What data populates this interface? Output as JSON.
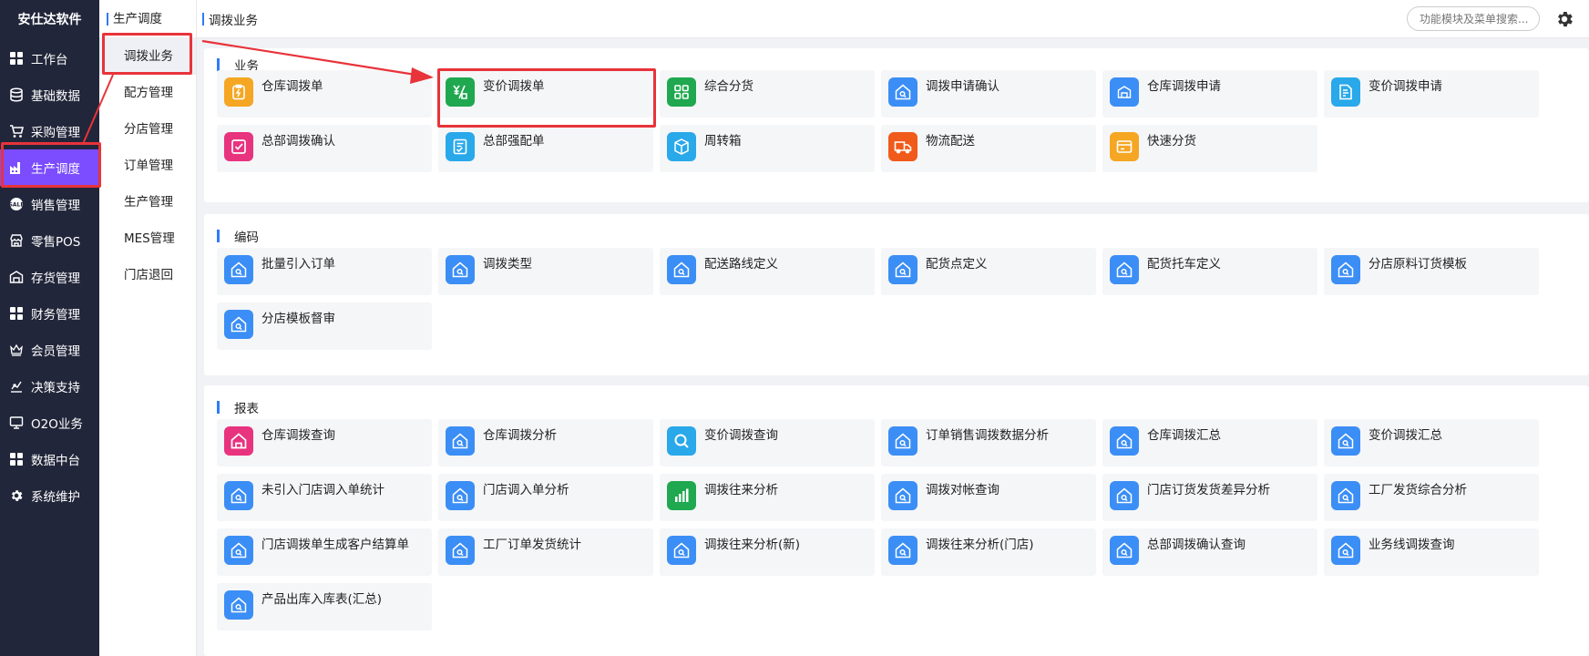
{
  "brand": "安仕达软件",
  "nav": [
    {
      "label": "工作台",
      "icon": "grid-icon"
    },
    {
      "label": "基础数据",
      "icon": "database-icon"
    },
    {
      "label": "采购管理",
      "icon": "cart-icon"
    },
    {
      "label": "生产调度",
      "icon": "factory-icon"
    },
    {
      "label": "销售管理",
      "icon": "sale-badge-icon"
    },
    {
      "label": "零售POS",
      "icon": "store-icon"
    },
    {
      "label": "存货管理",
      "icon": "warehouse-icon"
    },
    {
      "label": "财务管理",
      "icon": "grid-icon"
    },
    {
      "label": "会员管理",
      "icon": "crown-icon"
    },
    {
      "label": "决策支持",
      "icon": "chart-line-icon"
    },
    {
      "label": "O2O业务",
      "icon": "monitor-icon"
    },
    {
      "label": "数据中台",
      "icon": "grid-icon"
    },
    {
      "label": "系统维护",
      "icon": "gear-icon"
    }
  ],
  "submenu": {
    "title": "生产调度",
    "items": [
      "调拨业务",
      "配方管理",
      "分店管理",
      "订单管理",
      "生产管理",
      "MES管理",
      "门店退回"
    ]
  },
  "topbar": {
    "breadcrumb": "调拨业务",
    "search_placeholder": "功能模块及菜单搜索..."
  },
  "sections": [
    {
      "title": "业务",
      "items": [
        {
          "label": "仓库调拨单",
          "icon": "clipboard-bolt-icon",
          "color": "#f5a623"
        },
        {
          "label": "变价调拨单",
          "icon": "price-change-icon",
          "color": "#1fa84f"
        },
        {
          "label": "综合分货",
          "icon": "apps-icon",
          "color": "#1fa84f"
        },
        {
          "label": "调拨申请确认",
          "icon": "house-search-icon",
          "color": "#3b8ef5"
        },
        {
          "label": "仓库调拨申请",
          "icon": "warehouse-icon",
          "color": "#3b8ef5"
        },
        {
          "label": "变价调拨申请",
          "icon": "document-icon",
          "color": "#29a8ea"
        },
        {
          "label": "总部调拨确认",
          "icon": "checkbox-icon",
          "color": "#e8337f"
        },
        {
          "label": "总部强配单",
          "icon": "checklist-icon",
          "color": "#29a8ea"
        },
        {
          "label": "周转箱",
          "icon": "box-icon",
          "color": "#29a8ea"
        },
        {
          "label": "物流配送",
          "icon": "truck-icon",
          "color": "#f05a1a"
        },
        {
          "label": "快速分货",
          "icon": "card-icon",
          "color": "#f5a623"
        }
      ]
    },
    {
      "title": "编码",
      "items": [
        {
          "label": "批量引入订单",
          "icon": "house-search-icon",
          "color": "#3b8ef5"
        },
        {
          "label": "调拨类型",
          "icon": "house-search-icon",
          "color": "#3b8ef5"
        },
        {
          "label": "配送路线定义",
          "icon": "house-search-icon",
          "color": "#3b8ef5"
        },
        {
          "label": "配货点定义",
          "icon": "house-search-icon",
          "color": "#3b8ef5"
        },
        {
          "label": "配货托车定义",
          "icon": "house-search-icon",
          "color": "#3b8ef5"
        },
        {
          "label": "分店原料订货模板",
          "icon": "house-search-icon",
          "color": "#3b8ef5"
        },
        {
          "label": "分店模板督审",
          "icon": "house-search-icon",
          "color": "#3b8ef5"
        }
      ]
    },
    {
      "title": "报表",
      "items": [
        {
          "label": "仓库调拨查询",
          "icon": "house-pink-icon",
          "color": "#e8337f"
        },
        {
          "label": "仓库调拨分析",
          "icon": "house-search-icon",
          "color": "#3b8ef5"
        },
        {
          "label": "变价调拨查询",
          "icon": "magnifier-icon",
          "color": "#29a8ea"
        },
        {
          "label": "订单销售调拨数据分析",
          "icon": "house-search-icon",
          "color": "#3b8ef5"
        },
        {
          "label": "仓库调拨汇总",
          "icon": "house-search-icon",
          "color": "#3b8ef5"
        },
        {
          "label": "变价调拨汇总",
          "icon": "house-search-icon",
          "color": "#3b8ef5"
        },
        {
          "label": "未引入门店调入单统计",
          "icon": "house-search-icon",
          "color": "#3b8ef5"
        },
        {
          "label": "门店调入单分析",
          "icon": "house-search-icon",
          "color": "#3b8ef5"
        },
        {
          "label": "调拨往来分析",
          "icon": "bar-chart-icon",
          "color": "#1fa84f"
        },
        {
          "label": "调拨对帐查询",
          "icon": "house-search-icon",
          "color": "#3b8ef5"
        },
        {
          "label": "门店订货发货差异分析",
          "icon": "house-search-icon",
          "color": "#3b8ef5"
        },
        {
          "label": "工厂发货综合分析",
          "icon": "house-search-icon",
          "color": "#3b8ef5"
        },
        {
          "label": "门店调拨单生成客户结算单",
          "icon": "house-search-icon",
          "color": "#3b8ef5"
        },
        {
          "label": "工厂订单发货统计",
          "icon": "house-search-icon",
          "color": "#3b8ef5"
        },
        {
          "label": "调拨往来分析(新)",
          "icon": "house-search-icon",
          "color": "#3b8ef5"
        },
        {
          "label": "调拨往来分析(门店)",
          "icon": "house-search-icon",
          "color": "#3b8ef5"
        },
        {
          "label": "总部调拨确认查询",
          "icon": "house-search-icon",
          "color": "#3b8ef5"
        },
        {
          "label": "业务线调拨查询",
          "icon": "house-search-icon",
          "color": "#3b8ef5"
        },
        {
          "label": "产品出库入库表(汇总)",
          "icon": "house-search-icon",
          "color": "#3b8ef5"
        }
      ]
    }
  ],
  "colors": {
    "accent": "#7b4dff",
    "annotation": "#e8333a",
    "sidebar_bg": "#22263a"
  }
}
